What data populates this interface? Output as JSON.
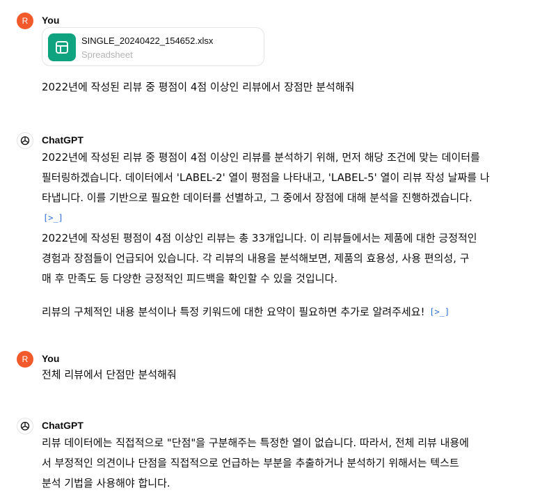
{
  "messages": [
    {
      "avatar": "R",
      "author": "You",
      "file": {
        "name": "SINGLE_20240422_154652.xlsx",
        "type": "Spreadsheet",
        "icon": "spreadsheet-icon"
      },
      "text": "2022년에 작성된 리뷰 중 평점이 4점 이상인 리뷰에서 장점만 분석해줘"
    },
    {
      "author": "ChatGPT",
      "lines1": [
        "2022년에 작성된 리뷰 중 평점이 4점 이상인 리뷰를 분석하기 위해, 먼저 해당 조건에 맞는 데이터를",
        "필터링하겠습니다. 데이터에서 'LABEL-2' 열이 평점을 나타내고, 'LABEL-5' 열이 리뷰 작성 날짜를 나",
        "타냅니다. 이를 기반으로 필요한 데이터를 선별하고, 그 중에서 장점에 대해 분석을 진행하겠습니다."
      ],
      "code_icon": "[>_]",
      "lines2": [
        "2022년에 작성된 평점이 4점 이상인 리뷰는 총 33개입니다. 이 리뷰들에서는 제품에 대한 긍정적인",
        "경험과 장점들이 언급되어 있습니다. 각 리뷰의 내용을 분석해보면, 제품의 효용성, 사용 편의성, 구",
        "매 후 만족도 등 다양한 긍정적인 피드백을 확인할 수 있을 것입니다."
      ],
      "line3": "리뷰의 구체적인 내용 분석이나 특정 키워드에 대한 요약이 필요하면 추가로 알려주세요!"
    },
    {
      "avatar": "R",
      "author": "You",
      "text": "전체 리뷰에서 단점만 분석해줘"
    },
    {
      "author": "ChatGPT",
      "lines": [
        "리뷰 데이터에는 직접적으로 \"단점\"을 구분해주는 특정한 열이 없습니다. 따라서, 전체 리뷰 내용에",
        "서 부정적인 의견이나 단점을 직접적으로 언급하는 부분을 추출하거나 분석하기 위해서는 텍스트",
        "분석 기법을 사용해야 합니다."
      ]
    }
  ]
}
